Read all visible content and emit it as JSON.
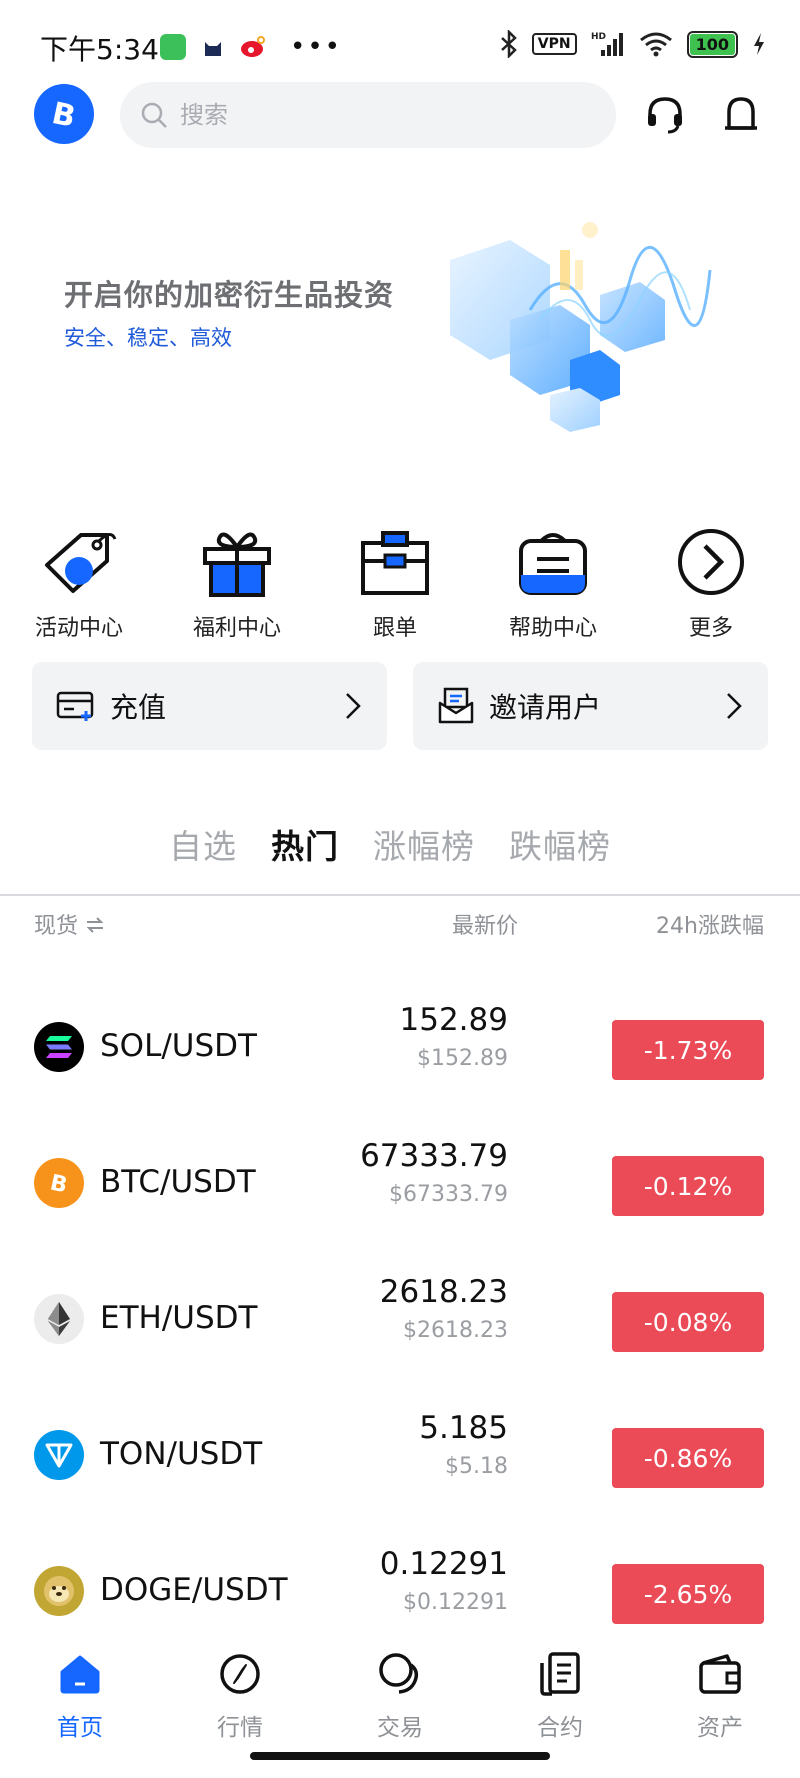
{
  "status_bar": {
    "time": "下午5:34",
    "vpn": "VPN",
    "hd": "HD",
    "battery": "100"
  },
  "header": {
    "logo_icon": "bitcoin-logo",
    "search_placeholder": "搜索",
    "headset_icon": "support-headset-icon",
    "bell_icon": "notification-bell-icon"
  },
  "banner": {
    "title": "开启你的加密衍生品投资",
    "subtitle": "安全、稳定、高效"
  },
  "shortcuts": [
    {
      "label": "活动中心",
      "icon": "tag-icon"
    },
    {
      "label": "福利中心",
      "icon": "gift-icon"
    },
    {
      "label": "跟单",
      "icon": "briefcase-icon"
    },
    {
      "label": "帮助中心",
      "icon": "help-bag-icon"
    },
    {
      "label": "更多",
      "icon": "chevron-right-circle-icon"
    }
  ],
  "actions": [
    {
      "label": "充值",
      "icon": "card-deposit-icon"
    },
    {
      "label": "邀请用户",
      "icon": "invite-letter-icon"
    }
  ],
  "market_tabs": [
    "自选",
    "热门",
    "涨幅榜",
    "跌幅榜"
  ],
  "active_tab": "热门",
  "columns": {
    "spot": "现货",
    "latest_price": "最新价",
    "change_24h": "24h涨跌幅"
  },
  "markets": [
    {
      "pair": "SOL/USDT",
      "price": "152.89",
      "usd": "$152.89",
      "change": "-1.73%",
      "coin_color": "#000000"
    },
    {
      "pair": "BTC/USDT",
      "price": "67333.79",
      "usd": "$67333.79",
      "change": "-0.12%",
      "coin_color": "#f7931a"
    },
    {
      "pair": "ETH/USDT",
      "price": "2618.23",
      "usd": "$2618.23",
      "change": "-0.08%",
      "coin_color": "#ececec"
    },
    {
      "pair": "TON/USDT",
      "price": "5.185",
      "usd": "$5.18",
      "change": "-0.86%",
      "coin_color": "#0098ea"
    },
    {
      "pair": "DOGE/USDT",
      "price": "0.12291",
      "usd": "$0.12291",
      "change": "-2.65%",
      "coin_color": "#c2a633"
    }
  ],
  "bottom_nav": [
    {
      "label": "首页",
      "icon": "home-icon",
      "active": true
    },
    {
      "label": "行情",
      "icon": "compass-icon",
      "active": false
    },
    {
      "label": "交易",
      "icon": "trade-coins-icon",
      "active": false
    },
    {
      "label": "合约",
      "icon": "contract-doc-icon",
      "active": false
    },
    {
      "label": "资产",
      "icon": "wallet-icon",
      "active": false
    }
  ],
  "colors": {
    "accent": "#1667ff",
    "down": "#ea4b57"
  }
}
